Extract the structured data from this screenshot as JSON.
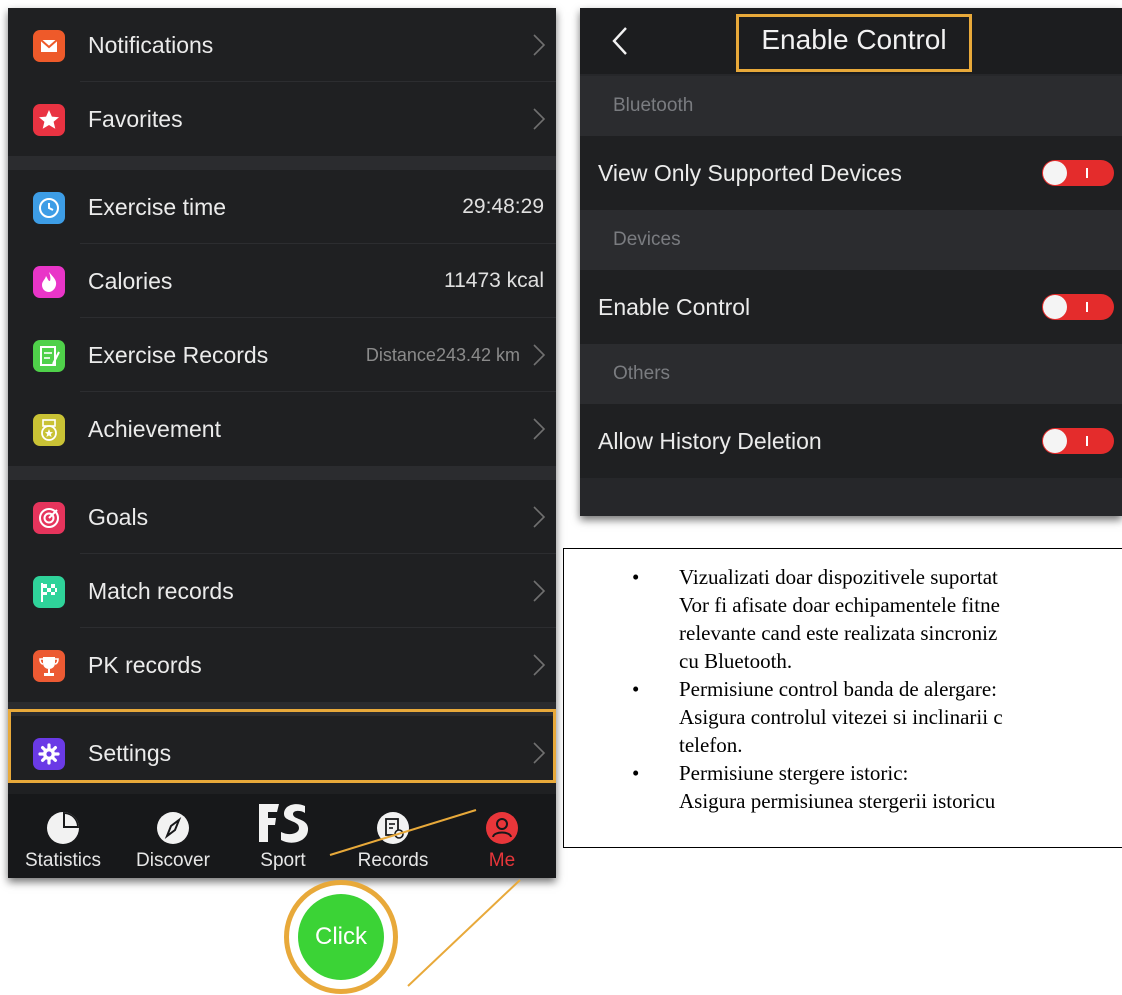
{
  "left_menu": {
    "items": [
      {
        "label": "Notifications",
        "value": "",
        "icon": "mail-icon",
        "color": "#ee5a2a"
      },
      {
        "label": "Favorites",
        "value": "",
        "icon": "star-icon",
        "color": "#e93342"
      },
      {
        "label": "Exercise time",
        "value": "29:48:29",
        "icon": "clock-icon",
        "color": "#3d9de6"
      },
      {
        "label": "Calories",
        "value": "11473 kcal",
        "icon": "flame-icon",
        "color": "#e935c8"
      },
      {
        "label": "Exercise Records",
        "value": "Distance243.42 km",
        "icon": "document-icon",
        "color": "#4fd14a"
      },
      {
        "label": "Achievement",
        "value": "",
        "icon": "medal-icon",
        "color": "#c9c235"
      },
      {
        "label": "Goals",
        "value": "",
        "icon": "target-icon",
        "color": "#e6345c"
      },
      {
        "label": "Match records",
        "value": "",
        "icon": "checkered-flag-icon",
        "color": "#2fd39a"
      },
      {
        "label": "PK records",
        "value": "",
        "icon": "trophy-icon",
        "color": "#ec5a33"
      },
      {
        "label": "Settings",
        "value": "",
        "icon": "gear-icon",
        "color": "#6a3ae6"
      }
    ]
  },
  "tabbar": {
    "tabs": [
      {
        "label": "Statistics",
        "icon": "pie-chart-icon"
      },
      {
        "label": "Discover",
        "icon": "compass-icon"
      },
      {
        "label": "Sport",
        "icon": "fs-logo-icon"
      },
      {
        "label": "Records",
        "icon": "records-icon"
      },
      {
        "label": "Me",
        "icon": "person-icon"
      }
    ],
    "active_color": "#e8363a"
  },
  "click_badge": {
    "label": "Click",
    "color": "#3bd336",
    "ring_color": "#e8a93a"
  },
  "right_panel": {
    "title": "Enable Control",
    "sections": [
      {
        "header": "Bluetooth",
        "row": "View Only Supported Devices",
        "toggle": "on"
      },
      {
        "header": "Devices",
        "row": "Enable Control",
        "toggle": "on"
      },
      {
        "header": "Others",
        "row": "Allow History Deletion",
        "toggle": "on"
      }
    ],
    "toggle_color": "#e42c2c"
  },
  "notes": {
    "items": [
      {
        "lines": [
          "Vizualizati doar dispozitivele suportat",
          "Vor fi afisate doar echipamentele fitne",
          "relevante cand este realizata sincroniz",
          "cu Bluetooth."
        ]
      },
      {
        "lines": [
          "Permisiune control banda de alergare:",
          "Asigura controlul vitezei si inclinarii c",
          "telefon."
        ]
      },
      {
        "lines": [
          "Permisiune stergere istoric:",
          "Asigura permisiunea stergerii istoricu"
        ]
      }
    ]
  }
}
